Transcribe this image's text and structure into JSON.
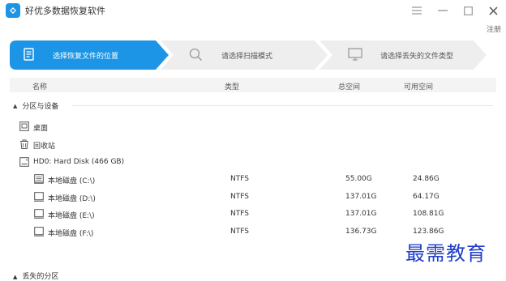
{
  "app": {
    "title": "好优多数据恢复软件",
    "register": "注册"
  },
  "steps": [
    {
      "label": "选择恢复文件的位置",
      "icon": "document-icon",
      "active": true
    },
    {
      "label": "请选择扫描模式",
      "icon": "search-icon",
      "active": false
    },
    {
      "label": "请选择丢失的文件类型",
      "icon": "monitor-icon",
      "active": false
    }
  ],
  "columns": {
    "name": "名称",
    "type": "类型",
    "total": "总空间",
    "free": "可用空间"
  },
  "section": {
    "label": "分区与设备"
  },
  "items": {
    "desktop": "桌面",
    "recycle": "回收站",
    "disk": "HD0: Hard Disk (466 GB)"
  },
  "partitions": [
    {
      "name": "本地磁盘 (C:\\)",
      "type": "NTFS",
      "total": "55.00G",
      "free": "24.86G"
    },
    {
      "name": "本地磁盘 (D:\\)",
      "type": "NTFS",
      "total": "137.01G",
      "free": "64.17G"
    },
    {
      "name": "本地磁盘 (E:\\)",
      "type": "NTFS",
      "total": "137.01G",
      "free": "108.81G"
    },
    {
      "name": "本地磁盘 (F:\\)",
      "type": "NTFS",
      "total": "136.73G",
      "free": "123.86G"
    }
  ],
  "lost_section": {
    "label": "丢失的分区"
  },
  "watermark": "最需教育",
  "colors": {
    "accent": "#1d95e6",
    "inactive_step": "#eeeeee",
    "watermark": "#1f3cc8"
  }
}
